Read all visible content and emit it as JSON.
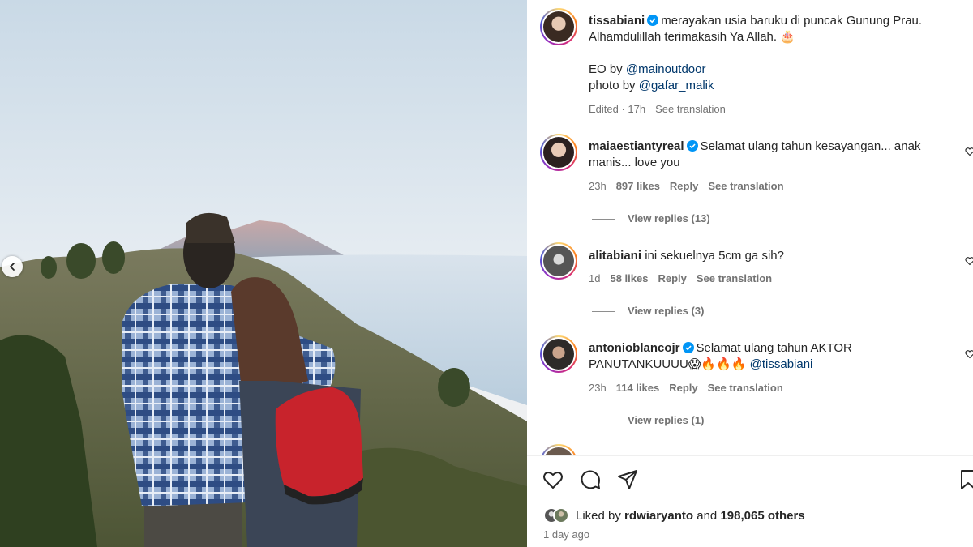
{
  "post": {
    "author": "tissabiani",
    "caption_line1": "merayakan usia baruku di puncak Gunung Prau.",
    "caption_line2": "Alhamdulillah terimakasih Ya Allah. 🎂",
    "eo_label": "EO by",
    "eo_mention": "@mainoutdoor",
    "photo_label": "photo by",
    "photo_mention": "@gafar_malik",
    "edited": "Edited · 17h",
    "see_translation": "See translation"
  },
  "comments": [
    {
      "user": "maiaestiantyreal",
      "verified": true,
      "text": "Selamat ulang tahun kesayangan... anak manis... love you",
      "time": "23h",
      "likes": "897 likes",
      "reply": "Reply",
      "translate": "See translation",
      "view_replies": "View replies (13)"
    },
    {
      "user": "alitabiani",
      "verified": false,
      "text": "ini sekuelnya 5cm ga sih?",
      "time": "1d",
      "likes": "58 likes",
      "reply": "Reply",
      "translate": "See translation",
      "view_replies": "View replies (3)"
    },
    {
      "user": "antonioblancojr",
      "verified": true,
      "text_line1": "Selamat ulang tahun AKTOR",
      "text_line2": "PANUTANKUUUU😱🔥🔥🔥",
      "mention": "@tissabiani",
      "time": "23h",
      "likes": "114 likes",
      "reply": "Reply",
      "translate": "See translation",
      "view_replies": "View replies (1)"
    }
  ],
  "footer": {
    "liked_by_label": "Liked by",
    "liked_by_user": "rdwiaryanto",
    "and_label": "and",
    "others": "198,065 others",
    "time_ago": "1 day ago"
  },
  "icons": {
    "verified": "verified-badge-icon",
    "like": "heart-icon",
    "comment": "comment-icon",
    "share": "share-icon",
    "save": "bookmark-icon",
    "prev": "chevron-left-icon"
  },
  "colors": {
    "verified": "#0095f6",
    "mention": "#00376b",
    "meta": "#737373"
  }
}
